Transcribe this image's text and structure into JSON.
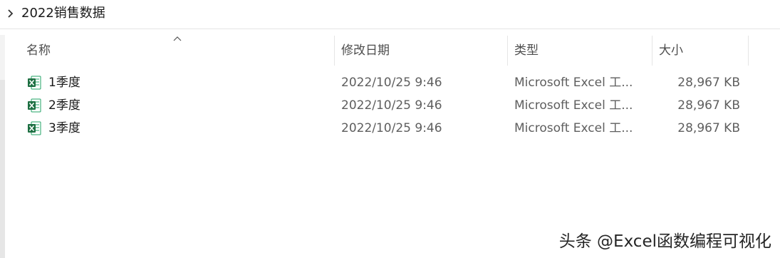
{
  "breadcrumb": {
    "folder": "2022销售数据"
  },
  "columns": {
    "name": "名称",
    "date": "修改日期",
    "type": "类型",
    "size": "大小"
  },
  "files": [
    {
      "name": "1季度",
      "date": "2022/10/25 9:46",
      "type": "Microsoft Excel 工...",
      "size": "28,967 KB",
      "icon": "excel-file-icon"
    },
    {
      "name": "2季度",
      "date": "2022/10/25 9:46",
      "type": "Microsoft Excel 工...",
      "size": "28,967 KB",
      "icon": "excel-file-icon"
    },
    {
      "name": "3季度",
      "date": "2022/10/25 9:46",
      "type": "Microsoft Excel 工...",
      "size": "28,967 KB",
      "icon": "excel-file-icon"
    }
  ],
  "watermark": "头条 @Excel函数编程可视化",
  "colors": {
    "excel_green": "#1d6f42",
    "header_text": "#4d4d4d",
    "divider": "#e5e5e5"
  }
}
